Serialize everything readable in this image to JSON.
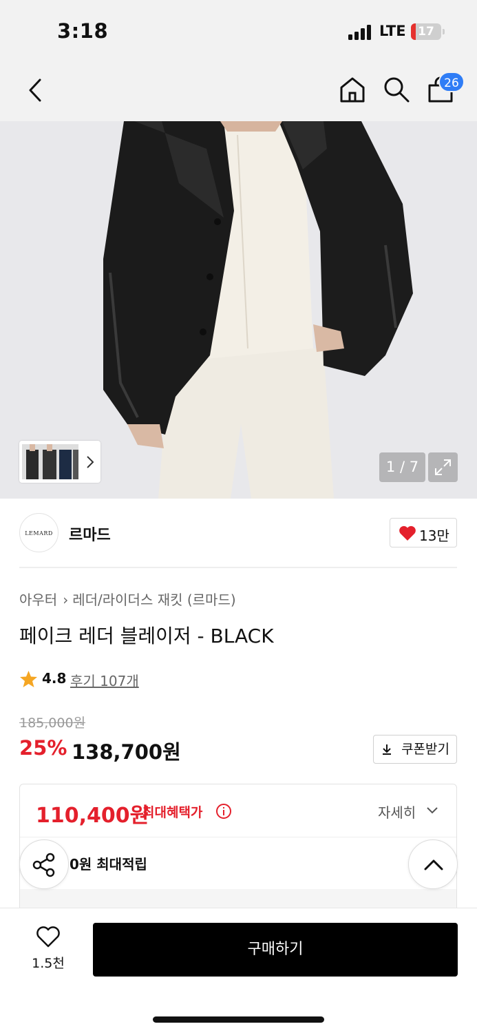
{
  "status_bar": {
    "time": "3:18",
    "network": "LTE",
    "battery": "17"
  },
  "nav": {
    "cart_count": "26",
    "icons": [
      "back-icon",
      "home-icon",
      "search-icon",
      "cart-icon"
    ]
  },
  "gallery": {
    "counter": "1 / 7"
  },
  "brand": {
    "logo_text": "LEMARD",
    "name": "르마드",
    "likes": "13만"
  },
  "breadcrumb": {
    "category": "아우터",
    "subcategory": "레더/라이더스 재킷 (르마드)"
  },
  "product": {
    "title": "페이크 레더 블레이저 - BLACK",
    "rating": "4.8",
    "reviews": "후기 107개",
    "original_price": "185,000원",
    "discount_rate": "25%",
    "sale_price": "138,700원",
    "coupon_label": "쿠폰받기"
  },
  "benefit": {
    "max_price": "110,400원",
    "max_label": "최대혜택가",
    "detail_label": "자세히",
    "points": "0원 최대적립"
  },
  "bottom": {
    "wish_count": "1.5천",
    "buy_label": "구매하기"
  },
  "colors": {
    "accent_red": "#e4202c",
    "badge_blue": "#2f7df6",
    "heart_red": "#e4202c",
    "star": "#f5a623"
  }
}
